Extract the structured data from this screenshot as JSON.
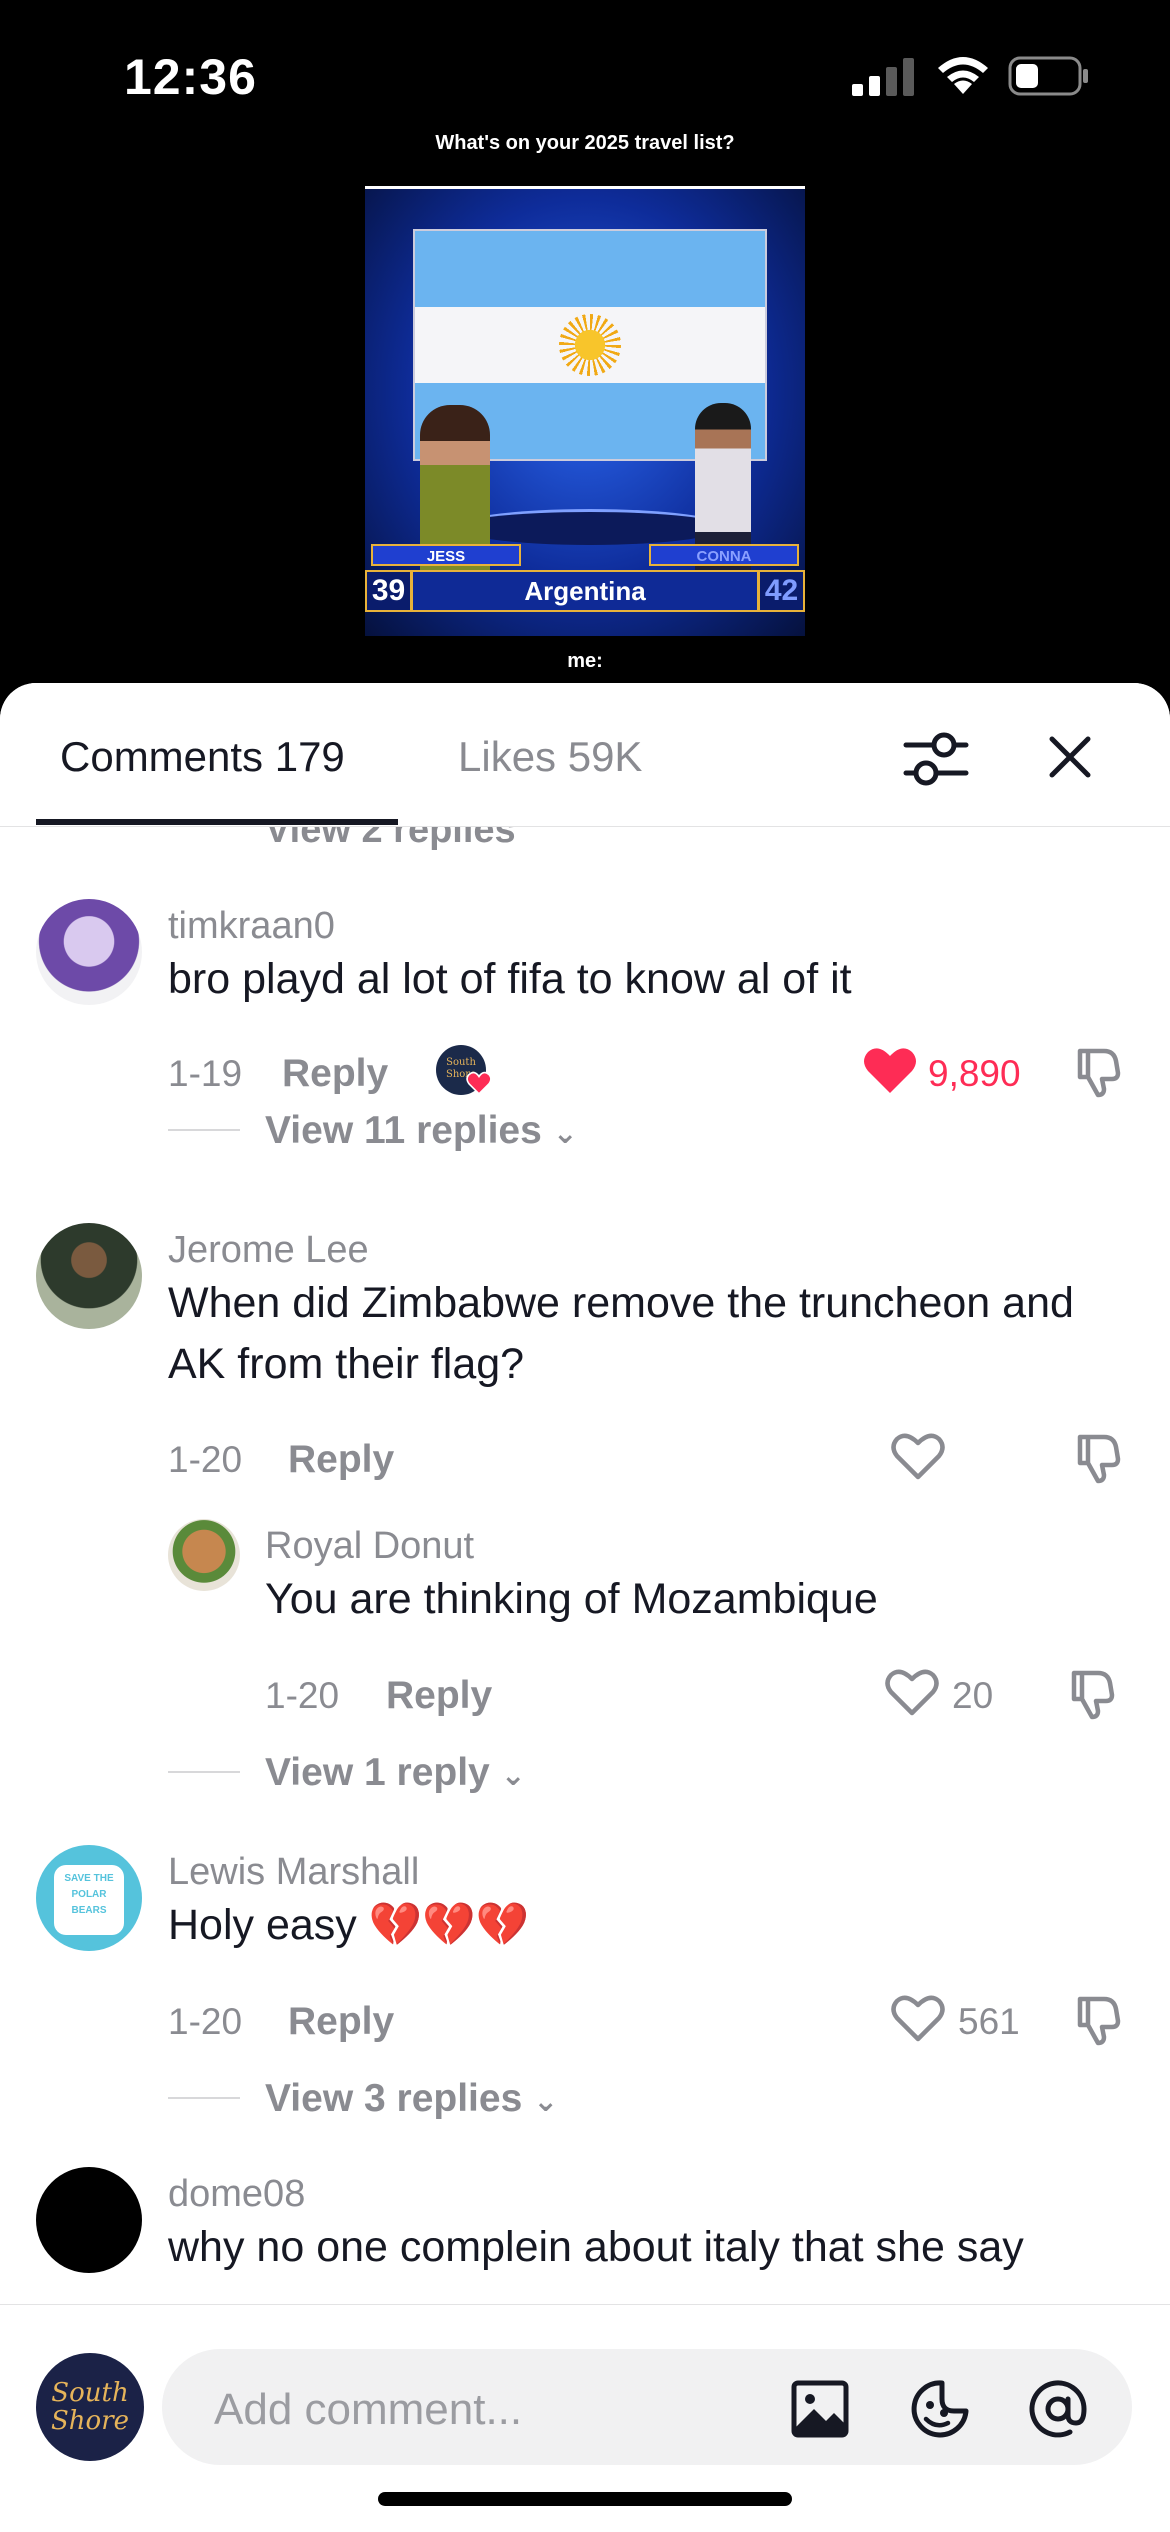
{
  "status_bar": {
    "time": "12:36"
  },
  "video": {
    "caption_top": "What's on your 2025 travel list?",
    "contestant_left": "JESS",
    "contestant_right": "CONNA",
    "score_left": "39",
    "score_right": "42",
    "answer": "Argentina",
    "caption_bottom": "me:"
  },
  "tabs": {
    "comments": "Comments 179",
    "likes": "Likes 59K"
  },
  "thread": {
    "cut_view_label": "View 2 replies",
    "comments": [
      {
        "username": "timkraan0",
        "text": "bro playd al lot of fifa to know al of it",
        "date": "1-19",
        "reply": "Reply",
        "likes": "9,890",
        "view_replies": "View 11 replies"
      },
      {
        "username": "Jerome Lee",
        "text": "When did Zimbabwe remove the truncheon and AK from their flag?",
        "date": "1-20",
        "reply": "Reply",
        "likes": ""
      },
      {
        "username": "Royal Donut",
        "text": "You are thinking of Mozambique",
        "date": "1-20",
        "reply": "Reply",
        "likes": "20",
        "view_replies": "View 1 reply"
      },
      {
        "username": "Lewis Marshall",
        "text": "Holy easy 💔💔💔",
        "date": "1-20",
        "reply": "Reply",
        "likes": "561",
        "view_replies": "View 3 replies"
      },
      {
        "username": "dome08",
        "text": "why no one complein about italy that she say",
        "date": "",
        "reply": "",
        "likes": ""
      }
    ],
    "lewis_avatar_text": "SAVE THE POLAR BEARS",
    "creator_avatar_text": "South Shore"
  },
  "composer": {
    "placeholder": "Add comment...",
    "avatar_text": "South Shore"
  },
  "colors": {
    "accent": "#fe2c55",
    "text": "#161823",
    "muted": "#8a8b91"
  }
}
